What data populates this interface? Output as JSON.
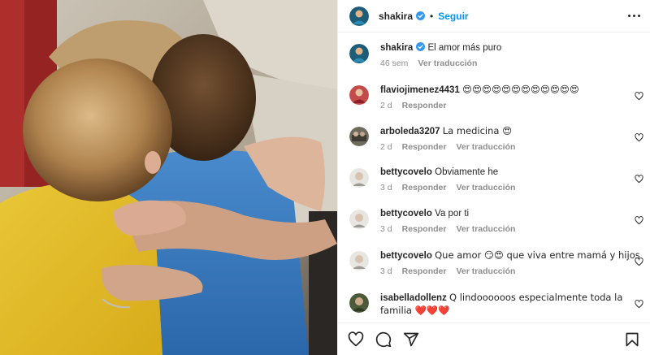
{
  "post": {
    "username": "shakira",
    "follow_label": "Seguir",
    "caption": {
      "username": "shakira",
      "text": "El amor más puro",
      "time": "46 sem",
      "translate": "Ver traducción"
    }
  },
  "comments": [
    {
      "username": "flaviojimenez4431",
      "text": "😍😍😍😍😍😍😍😍😍😍😍😍",
      "time": "2 d",
      "reply": "Responder",
      "translate": ""
    },
    {
      "username": "arboleda3207",
      "text": "La medicina 😍",
      "time": "2 d",
      "reply": "Responder",
      "translate": "Ver traducción"
    },
    {
      "username": "bettycovelo",
      "text": "Obviamente he",
      "time": "3 d",
      "reply": "Responder",
      "translate": "Ver traducción"
    },
    {
      "username": "bettycovelo",
      "text": "Va por ti",
      "time": "3 d",
      "reply": "Responder",
      "translate": "Ver traducción"
    },
    {
      "username": "bettycovelo",
      "text": "Que amor 😏😍 que viva entre mamá y hijos",
      "time": "3 d",
      "reply": "Responder",
      "translate": "Ver traducción"
    },
    {
      "username": "isabelladollenz",
      "text": "Q lindoooooos especialmente toda la familia ❤️❤️❤️",
      "time": "",
      "reply": "",
      "translate": ""
    }
  ],
  "colors": {
    "link_blue": "#0095f6",
    "muted": "#8e8e8e",
    "text": "#262626",
    "verified": "#3897f0"
  },
  "icons": [
    "verified-badge-icon",
    "more-options-icon",
    "heart-icon",
    "comment-icon",
    "share-icon",
    "bookmark-icon"
  ]
}
